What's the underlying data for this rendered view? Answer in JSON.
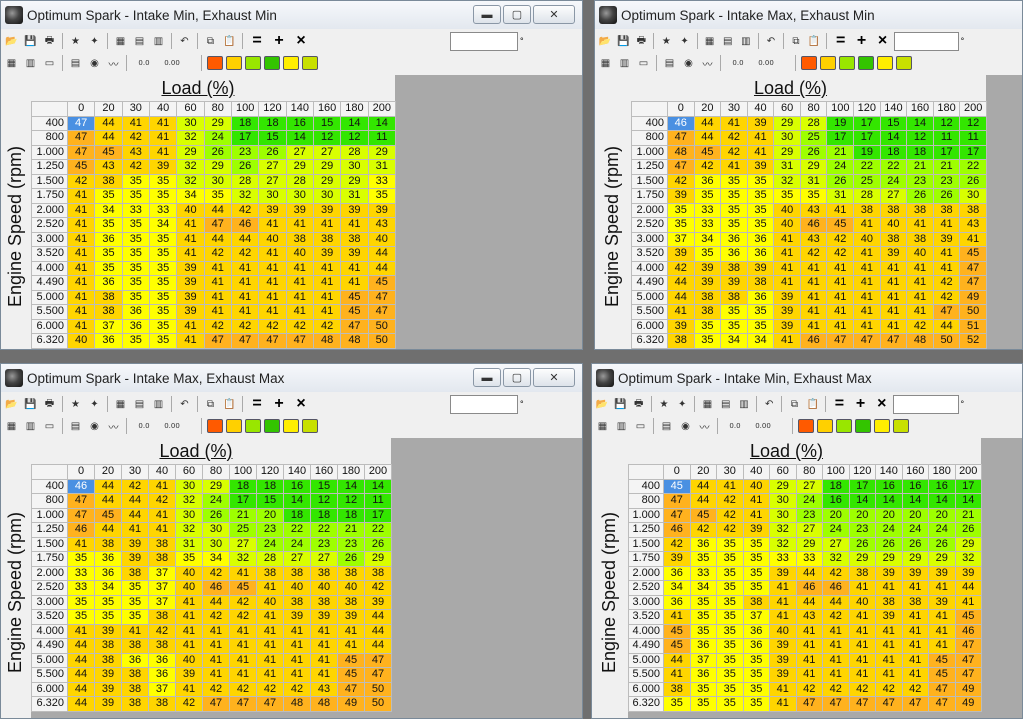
{
  "columns": [
    "0",
    "20",
    "30",
    "40",
    "60",
    "80",
    "100",
    "120",
    "140",
    "160",
    "180",
    "200"
  ],
  "rows": [
    "400",
    "800",
    "1.000",
    "1.250",
    "1.500",
    "1.750",
    "2.000",
    "2.520",
    "3.000",
    "3.520",
    "4.000",
    "4.490",
    "5.000",
    "5.500",
    "6.000",
    "6.320"
  ],
  "axis_x_label": "Load (%)",
  "axis_y_label": "Engine Speed (rpm)",
  "toolbar": {
    "equals_symbol": "=",
    "plus_symbol": "+",
    "times_symbol": "×",
    "degree_symbol": "°",
    "label_a": "0.0",
    "label_b": "0.00"
  },
  "window_buttons": {
    "minimize": "▬",
    "maximize": "▢",
    "close": "✕"
  },
  "colors": {
    "selected": "#4a90e2",
    "orange": "#ffb21e",
    "yellow_orange": "#ffd500",
    "yellow": "#ffff00",
    "yellow_green": "#d9ff00",
    "lime": "#9eff00",
    "green": "#33e600"
  },
  "windows": [
    {
      "title": "Optimum Spark - Intake Min, Exhaust Min",
      "values": [
        [
          47,
          44,
          41,
          41,
          30,
          29,
          18,
          18,
          16,
          15,
          14,
          14
        ],
        [
          47,
          44,
          42,
          41,
          32,
          24,
          17,
          15,
          14,
          12,
          12,
          11
        ],
        [
          47,
          45,
          43,
          41,
          29,
          26,
          23,
          26,
          27,
          27,
          28,
          29
        ],
        [
          45,
          43,
          42,
          39,
          32,
          29,
          26,
          27,
          29,
          29,
          30,
          31
        ],
        [
          42,
          38,
          35,
          35,
          32,
          30,
          28,
          27,
          28,
          29,
          29,
          33
        ],
        [
          41,
          35,
          35,
          35,
          34,
          35,
          32,
          30,
          30,
          30,
          31,
          35
        ],
        [
          41,
          34,
          33,
          33,
          40,
          44,
          42,
          39,
          39,
          39,
          39,
          39
        ],
        [
          41,
          35,
          35,
          34,
          41,
          47,
          46,
          41,
          41,
          41,
          41,
          43
        ],
        [
          41,
          36,
          35,
          35,
          41,
          44,
          44,
          40,
          38,
          38,
          38,
          40
        ],
        [
          41,
          35,
          35,
          35,
          41,
          42,
          42,
          41,
          40,
          39,
          39,
          44
        ],
        [
          41,
          35,
          35,
          35,
          39,
          41,
          41,
          41,
          41,
          41,
          41,
          44
        ],
        [
          41,
          36,
          35,
          35,
          39,
          41,
          41,
          41,
          41,
          41,
          41,
          45
        ],
        [
          41,
          38,
          35,
          35,
          39,
          41,
          41,
          41,
          41,
          41,
          45,
          47
        ],
        [
          41,
          38,
          36,
          35,
          39,
          41,
          41,
          41,
          41,
          41,
          45,
          47
        ],
        [
          41,
          37,
          36,
          35,
          41,
          42,
          42,
          42,
          42,
          42,
          47,
          50
        ],
        [
          40,
          36,
          35,
          35,
          41,
          47,
          47,
          47,
          47,
          48,
          48,
          50
        ]
      ]
    },
    {
      "title": "Optimum Spark - Intake Max, Exhaust Min",
      "values": [
        [
          46,
          44,
          41,
          39,
          29,
          28,
          19,
          17,
          15,
          14,
          12,
          12
        ],
        [
          47,
          44,
          42,
          41,
          30,
          25,
          17,
          17,
          14,
          12,
          11,
          11
        ],
        [
          48,
          45,
          42,
          41,
          29,
          26,
          21,
          19,
          18,
          18,
          17,
          17
        ],
        [
          47,
          42,
          41,
          39,
          31,
          29,
          24,
          22,
          22,
          21,
          21,
          22
        ],
        [
          42,
          36,
          35,
          35,
          32,
          31,
          26,
          25,
          24,
          23,
          23,
          26
        ],
        [
          39,
          35,
          35,
          35,
          35,
          35,
          31,
          28,
          27,
          26,
          26,
          30
        ],
        [
          35,
          33,
          35,
          35,
          40,
          43,
          41,
          38,
          38,
          38,
          38,
          38
        ],
        [
          35,
          33,
          35,
          35,
          40,
          46,
          45,
          41,
          40,
          41,
          41,
          43
        ],
        [
          37,
          34,
          36,
          36,
          41,
          43,
          42,
          40,
          38,
          38,
          39,
          41
        ],
        [
          39,
          35,
          36,
          36,
          41,
          42,
          42,
          41,
          39,
          40,
          41,
          45
        ],
        [
          42,
          39,
          38,
          39,
          41,
          41,
          41,
          41,
          41,
          41,
          41,
          47
        ],
        [
          44,
          39,
          39,
          38,
          41,
          41,
          41,
          41,
          41,
          41,
          42,
          47
        ],
        [
          44,
          38,
          38,
          36,
          39,
          41,
          41,
          41,
          41,
          41,
          42,
          49
        ],
        [
          41,
          38,
          35,
          35,
          39,
          41,
          41,
          41,
          41,
          41,
          47,
          50
        ],
        [
          39,
          35,
          35,
          35,
          39,
          41,
          41,
          41,
          41,
          42,
          44,
          51
        ],
        [
          38,
          35,
          34,
          34,
          41,
          46,
          47,
          47,
          47,
          48,
          50,
          52
        ]
      ]
    },
    {
      "title": "Optimum Spark - Intake Max, Exhaust Max",
      "values": [
        [
          46,
          44,
          42,
          41,
          30,
          29,
          18,
          18,
          16,
          15,
          14,
          14
        ],
        [
          47,
          44,
          44,
          42,
          32,
          24,
          17,
          15,
          14,
          12,
          12,
          11
        ],
        [
          47,
          45,
          44,
          41,
          30,
          26,
          21,
          20,
          18,
          18,
          18,
          17
        ],
        [
          46,
          44,
          41,
          41,
          32,
          30,
          25,
          23,
          22,
          22,
          21,
          22
        ],
        [
          41,
          38,
          39,
          38,
          31,
          30,
          27,
          24,
          24,
          23,
          23,
          26
        ],
        [
          35,
          36,
          39,
          38,
          35,
          34,
          32,
          28,
          27,
          27,
          26,
          29
        ],
        [
          33,
          36,
          38,
          37,
          40,
          42,
          41,
          38,
          38,
          38,
          38,
          38
        ],
        [
          33,
          34,
          35,
          37,
          40,
          46,
          45,
          41,
          40,
          40,
          40,
          42
        ],
        [
          35,
          35,
          35,
          37,
          41,
          44,
          42,
          40,
          38,
          38,
          38,
          39
        ],
        [
          35,
          35,
          35,
          38,
          41,
          42,
          42,
          41,
          39,
          39,
          39,
          44
        ],
        [
          41,
          39,
          41,
          42,
          41,
          41,
          41,
          41,
          41,
          41,
          41,
          44
        ],
        [
          44,
          38,
          38,
          38,
          41,
          41,
          41,
          41,
          41,
          41,
          41,
          44
        ],
        [
          44,
          38,
          36,
          36,
          40,
          41,
          41,
          41,
          41,
          41,
          45,
          47
        ],
        [
          44,
          39,
          38,
          36,
          39,
          41,
          41,
          41,
          41,
          41,
          45,
          47
        ],
        [
          44,
          39,
          38,
          37,
          41,
          42,
          42,
          42,
          42,
          43,
          47,
          50
        ],
        [
          44,
          39,
          38,
          38,
          42,
          47,
          47,
          47,
          48,
          48,
          49,
          50
        ]
      ]
    },
    {
      "title": "Optimum Spark - Intake Min, Exhaust Max",
      "values": [
        [
          45,
          44,
          41,
          40,
          29,
          27,
          18,
          17,
          16,
          16,
          16,
          17
        ],
        [
          47,
          44,
          42,
          41,
          30,
          24,
          16,
          14,
          14,
          14,
          14,
          14
        ],
        [
          47,
          45,
          42,
          41,
          30,
          23,
          20,
          20,
          20,
          20,
          20,
          21
        ],
        [
          46,
          42,
          42,
          39,
          32,
          27,
          24,
          23,
          24,
          24,
          24,
          26
        ],
        [
          42,
          36,
          35,
          35,
          32,
          29,
          27,
          26,
          26,
          26,
          26,
          29
        ],
        [
          39,
          35,
          35,
          35,
          33,
          33,
          32,
          29,
          29,
          29,
          29,
          32
        ],
        [
          36,
          33,
          35,
          35,
          39,
          44,
          42,
          38,
          39,
          39,
          39,
          39
        ],
        [
          34,
          34,
          35,
          35,
          41,
          46,
          46,
          41,
          41,
          41,
          41,
          44
        ],
        [
          36,
          35,
          35,
          38,
          41,
          44,
          44,
          40,
          38,
          38,
          39,
          41
        ],
        [
          41,
          35,
          35,
          37,
          41,
          43,
          42,
          41,
          39,
          41,
          41,
          45
        ],
        [
          45,
          35,
          35,
          36,
          40,
          41,
          41,
          41,
          41,
          41,
          41,
          46
        ],
        [
          45,
          36,
          35,
          36,
          39,
          41,
          41,
          41,
          41,
          41,
          41,
          47
        ],
        [
          44,
          37,
          35,
          35,
          39,
          41,
          41,
          41,
          41,
          41,
          45,
          47
        ],
        [
          41,
          36,
          35,
          35,
          39,
          41,
          41,
          41,
          41,
          41,
          45,
          47
        ],
        [
          38,
          35,
          35,
          35,
          41,
          42,
          42,
          42,
          42,
          42,
          47,
          49
        ],
        [
          35,
          35,
          35,
          35,
          41,
          47,
          47,
          47,
          47,
          47,
          47,
          49
        ]
      ]
    }
  ]
}
